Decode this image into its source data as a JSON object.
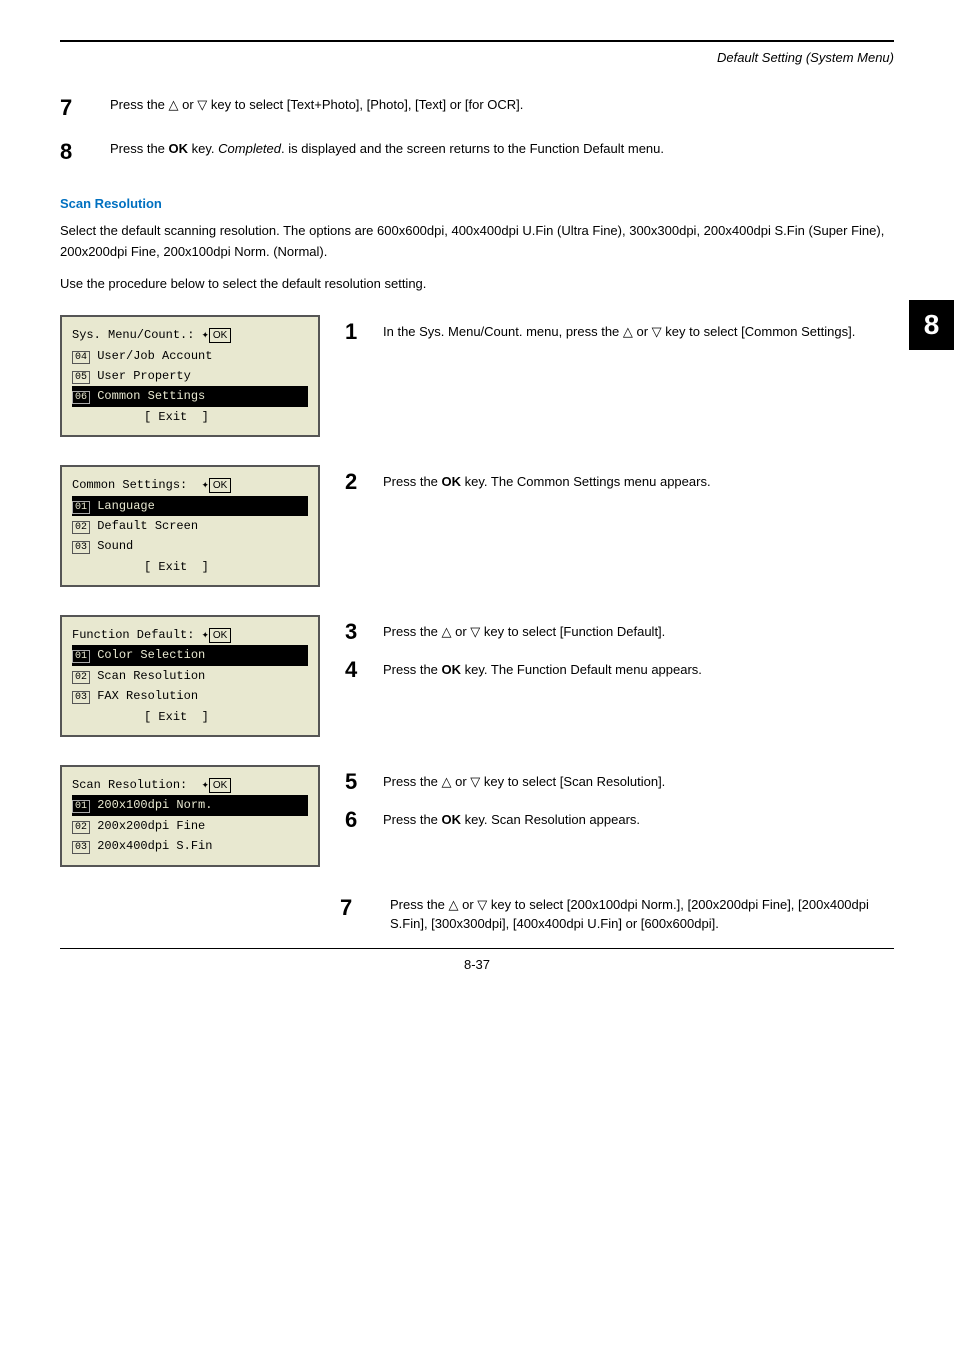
{
  "page": {
    "header_title": "Default Setting (System Menu)",
    "footer_page": "8-37",
    "section_badge": "8"
  },
  "top_steps": [
    {
      "number": "7",
      "text": "Press the △ or ▽ key to select [Text+Photo], [Photo], [Text] or [for OCR]."
    },
    {
      "number": "8",
      "text_parts": [
        "Press the ",
        "OK",
        " key. ",
        "Completed",
        ". is displayed and the screen returns to the Function Default menu."
      ]
    }
  ],
  "section": {
    "title": "Scan Resolution",
    "description": "Select the default scanning resolution. The options are 600x600dpi, 400x400dpi U.Fin (Ultra Fine), 300x300dpi, 200x400dpi S.Fin (Super Fine), 200x200dpi Fine, 200x100dpi Norm. (Normal).",
    "procedure_text": "Use the procedure below to select the default resolution setting."
  },
  "screens": [
    {
      "id": "screen1",
      "lines": [
        "Sys. Menu/Count.: ✦OK",
        "04 User/Job Account",
        "05 User Property",
        "06 Common Settings",
        "          [ Exit  ]"
      ],
      "highlight_line": 3
    },
    {
      "id": "screen2",
      "lines": [
        "Common Settings:  ✦OK",
        "01 Language",
        "02 Default Screen",
        "03 Sound",
        "          [ Exit  ]"
      ],
      "highlight_line": 1
    },
    {
      "id": "screen3",
      "lines": [
        "Function Default: ✦OK",
        "01 Color Selection",
        "02 Scan Resolution",
        "03 FAX Resolution",
        "          [ Exit  ]"
      ],
      "highlight_line": 1
    },
    {
      "id": "screen4",
      "lines": [
        "Scan Resolution:  ✦OK",
        "01 200x100dpi Norm.",
        "02 200x200dpi Fine",
        "03 200x400dpi S.Fin"
      ],
      "highlight_line": 1
    }
  ],
  "steps": [
    {
      "number": "1",
      "text": "In the Sys. Menu/Count. menu, press the △ or ▽ key to select [Common Settings]."
    },
    {
      "number": "2",
      "text_parts": [
        "Press the ",
        "OK",
        " key. The Common Settings menu appears."
      ]
    },
    {
      "number": "3",
      "text": "Press the △ or ▽ key to select [Function Default]."
    },
    {
      "number": "4",
      "text_parts": [
        "Press the ",
        "OK",
        " key. The Function Default menu appears."
      ]
    },
    {
      "number": "5",
      "text": "Press the △ or ▽ key to select [Scan Resolution]."
    },
    {
      "number": "6",
      "text_parts": [
        "Press the ",
        "OK",
        " key. Scan Resolution appears."
      ]
    },
    {
      "number": "7",
      "text": "Press the △ or ▽ key to select [200x100dpi Norm.], [200x200dpi Fine], [200x400dpi S.Fin], [300x300dpi], [400x400dpi U.Fin] or [600x600dpi]."
    }
  ]
}
